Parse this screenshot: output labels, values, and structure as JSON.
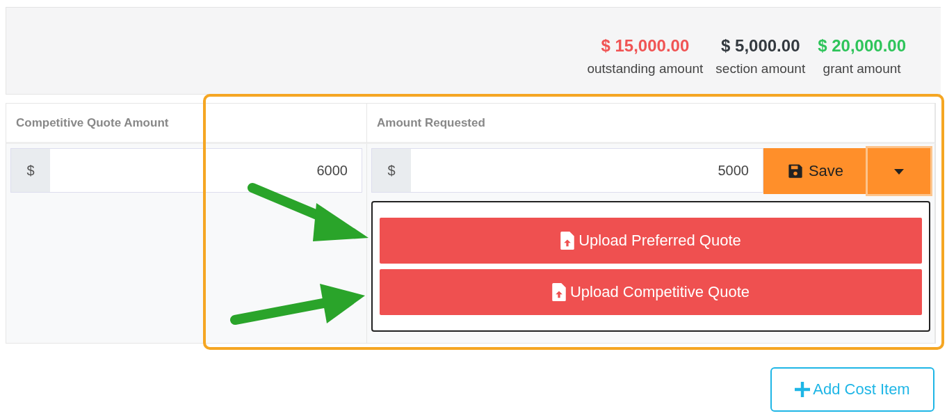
{
  "totals": [
    {
      "value": "$ 15,000.00",
      "label": "outstanding amount",
      "color": "#f05454"
    },
    {
      "value": "$ 5,000.00",
      "label": "section amount",
      "color": "#343a40"
    },
    {
      "value": "$ 20,000.00",
      "label": "grant amount",
      "color": "#2ec45a"
    }
  ],
  "table": {
    "columns": [
      "Competitive Quote Amount",
      "Amount Requested"
    ],
    "fields": [
      {
        "prefix": "$",
        "value": "6000"
      },
      {
        "prefix": "$",
        "value": "5000"
      }
    ]
  },
  "save_button": {
    "label": "Save",
    "menu_expanded": true
  },
  "menu_items": [
    "Upload Preferred Quote",
    "Upload Competitive Quote"
  ],
  "add_button": "Add Cost Item"
}
